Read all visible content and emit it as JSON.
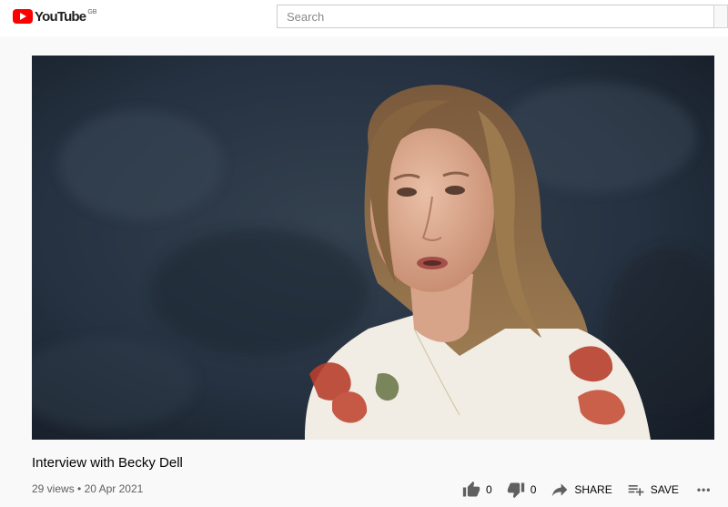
{
  "brand": {
    "name": "YouTube",
    "region": "GB",
    "accent": "#ff0000"
  },
  "search": {
    "placeholder": "Search"
  },
  "video": {
    "title": "Interview with Becky Dell",
    "views": "29 views",
    "separator": "•",
    "date": "20 Apr 2021"
  },
  "actions": {
    "like_icon": "thumb-up-icon",
    "like_count": "0",
    "dislike_icon": "thumb-down-icon",
    "dislike_count": "0",
    "share_icon": "share-icon",
    "share_label": "SHARE",
    "save_icon": "playlist-add-icon",
    "save_label": "SAVE",
    "more_icon": "more-horiz-icon",
    "more_label": "•••"
  }
}
